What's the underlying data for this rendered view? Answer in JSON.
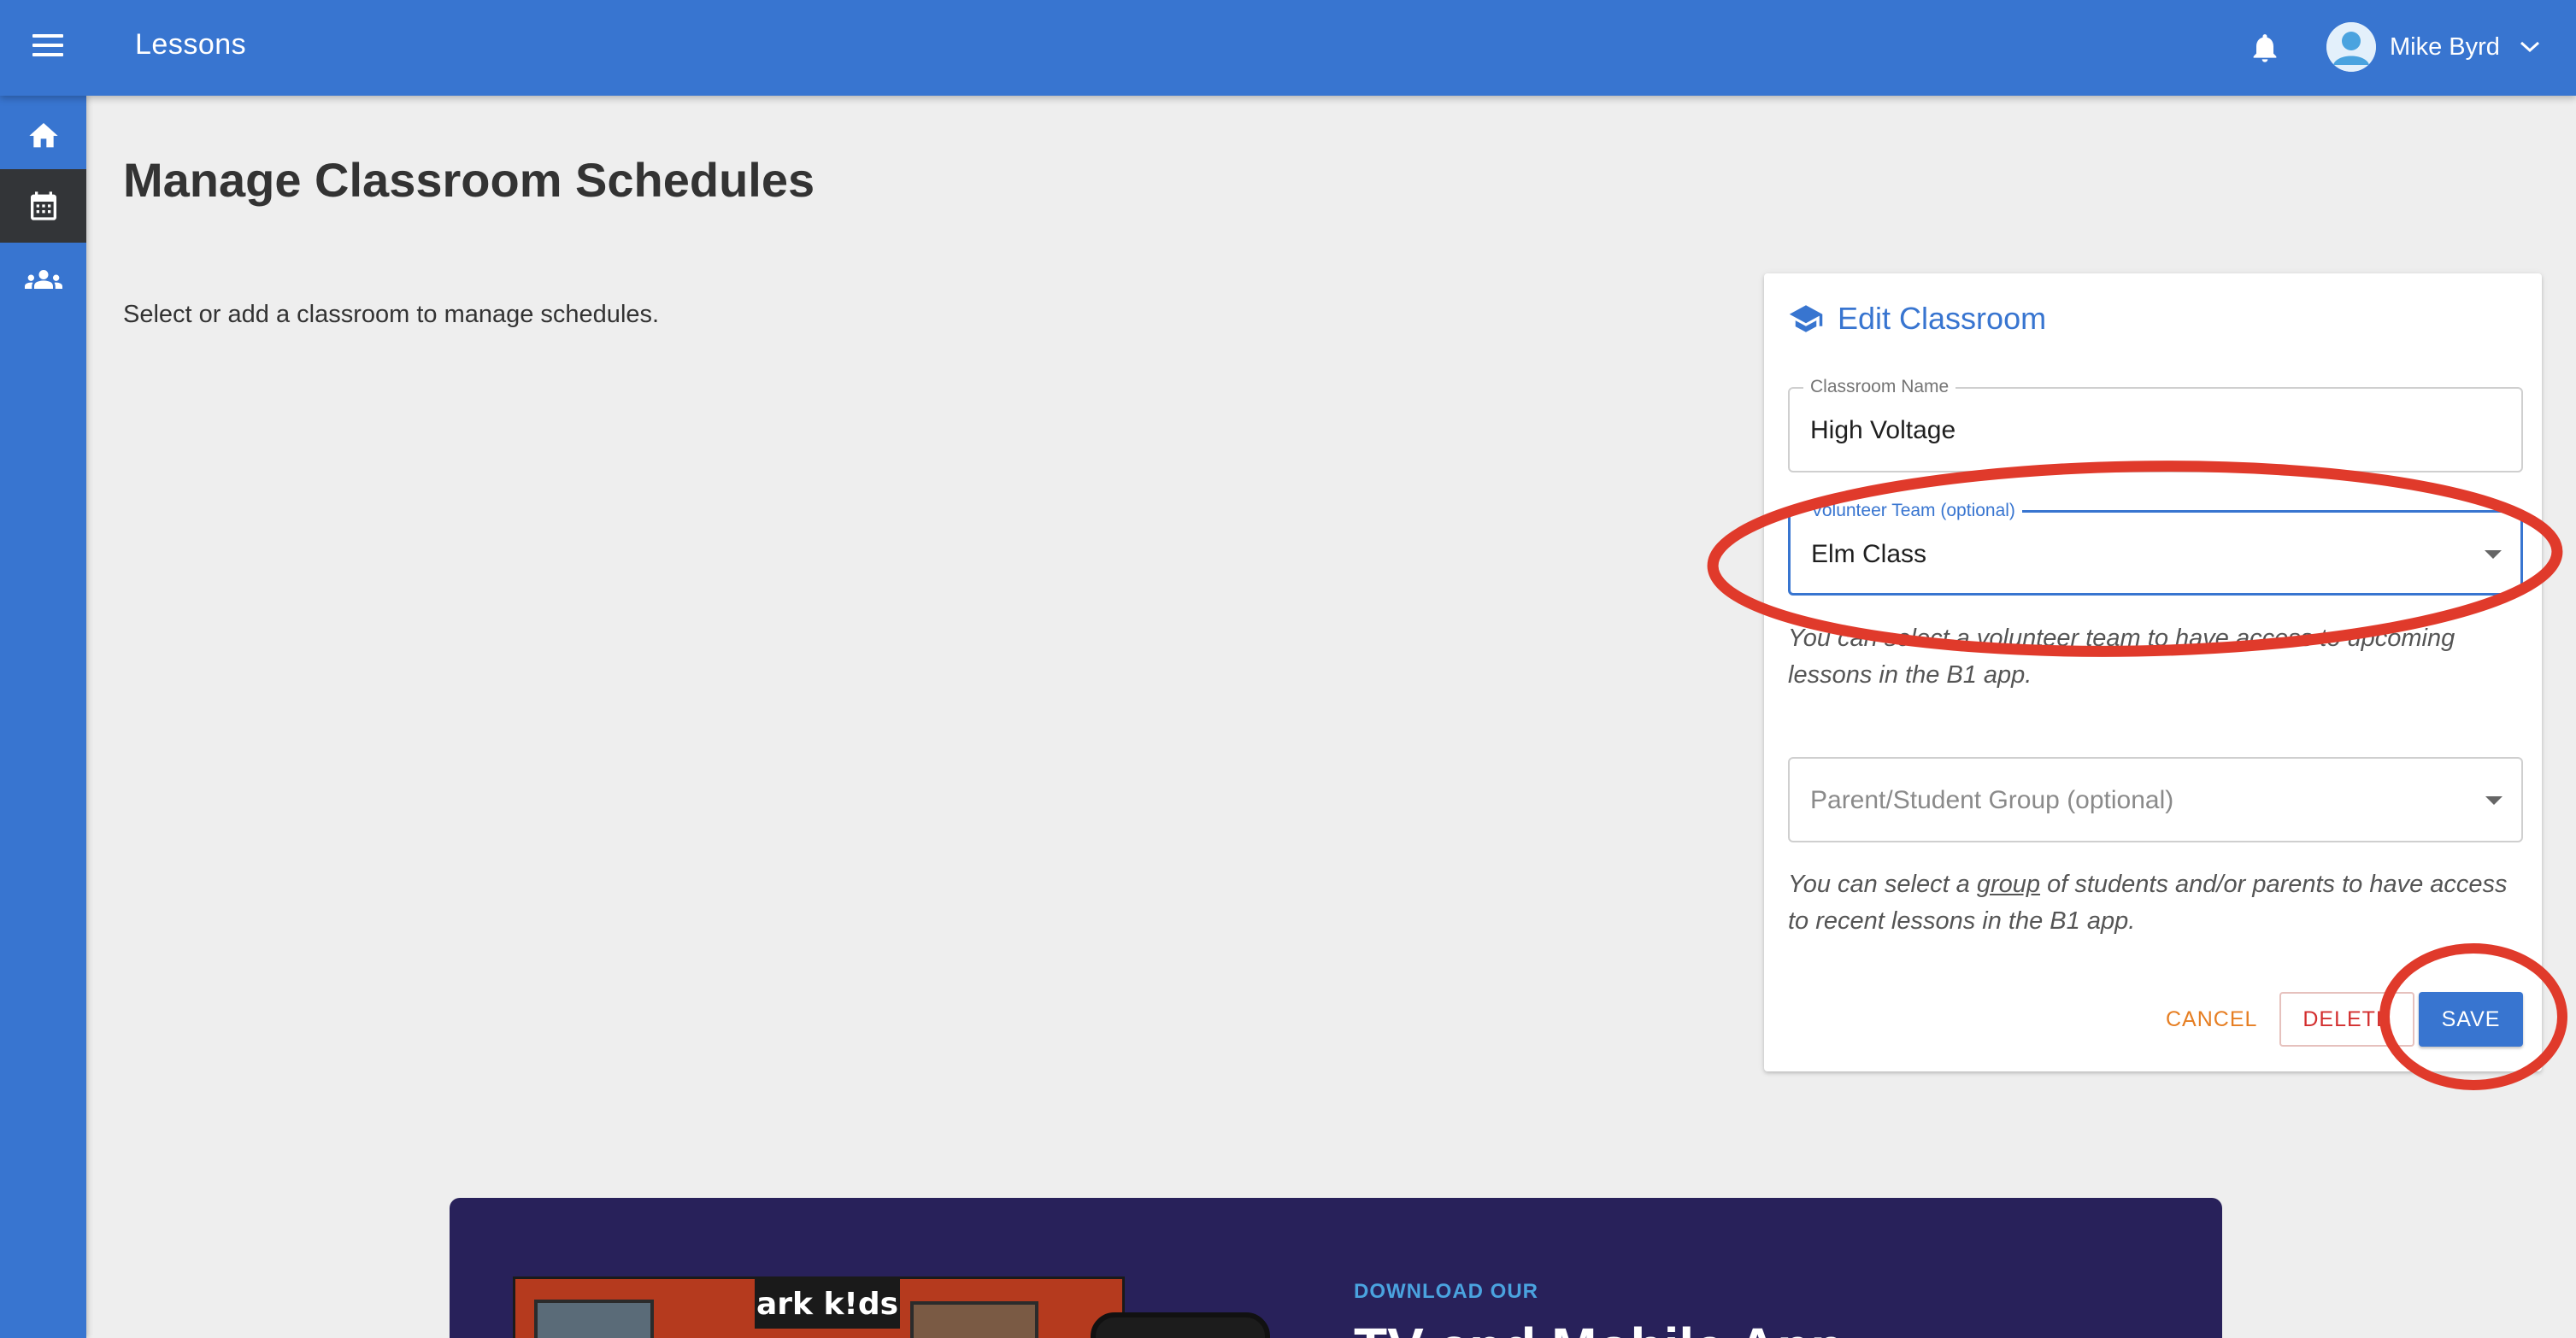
{
  "header": {
    "title": "Lessons",
    "user_name": "Mike Byrd"
  },
  "sidebar": {
    "items": [
      {
        "icon": "home-icon",
        "active": false
      },
      {
        "icon": "calendar-icon",
        "active": true
      },
      {
        "icon": "people-icon",
        "active": false
      }
    ]
  },
  "main": {
    "title": "Manage Classroom Schedules",
    "hint": "Select or add a classroom to manage schedules."
  },
  "edit_card": {
    "title": "Edit Classroom",
    "classroom_name_label": "Classroom Name",
    "classroom_name_value": "High Voltage",
    "volunteer_team_label": "Volunteer Team (optional)",
    "volunteer_team_value": "Elm Class",
    "volunteer_help_pre": "You can select a ",
    "volunteer_help_link": "volunteer team",
    "volunteer_help_post": " to have access to upcoming lessons in the B1 app.",
    "group_placeholder": "Parent/Student Group (optional)",
    "group_help_pre": "You can select a ",
    "group_help_link": "group",
    "group_help_post": " of students and/or parents to have access to recent lessons in the B1 app.",
    "cancel_label": "CANCEL",
    "delete_label": "DELETE",
    "save_label": "SAVE"
  },
  "promo": {
    "logo_text": "ark k!ds",
    "kicker": "DOWNLOAD OUR",
    "headline": "TV and Mobile App"
  },
  "colors": {
    "primary": "#3875d0",
    "sidebar_active": "#333538",
    "cancel": "#e67e22",
    "delete": "#d32f2f",
    "annotation": "#e03a2b",
    "promo_bg": "#28215a"
  }
}
